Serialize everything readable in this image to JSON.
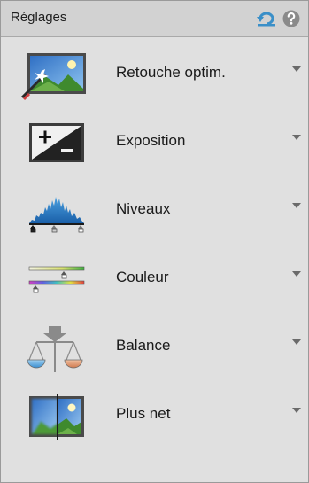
{
  "panel": {
    "title": "Réglages",
    "reset_icon": "reset-icon",
    "help_icon": "help-icon"
  },
  "items": [
    {
      "label": "Retouche optim.",
      "icon": "smart-fix-icon"
    },
    {
      "label": "Exposition",
      "icon": "exposure-icon"
    },
    {
      "label": "Niveaux",
      "icon": "levels-icon"
    },
    {
      "label": "Couleur",
      "icon": "color-icon"
    },
    {
      "label": "Balance",
      "icon": "balance-icon"
    },
    {
      "label": "Plus net",
      "icon": "sharpen-icon"
    }
  ],
  "colors": {
    "panel_background": "#e0e0e0",
    "header_background": "#d2d2d2",
    "reset_icon": "#3a8fc8",
    "help_icon": "#8a8a8a"
  }
}
